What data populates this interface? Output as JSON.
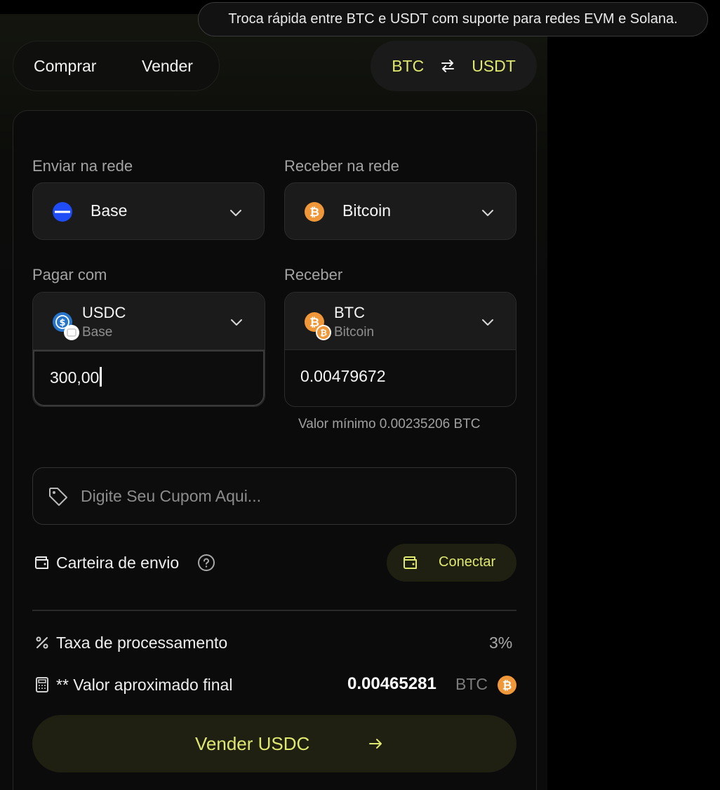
{
  "tooltip": "Troca rápida entre BTC e USDT com suporte para redes EVM e Solana.",
  "mode": {
    "buy": "Comprar",
    "sell": "Vender"
  },
  "pair": {
    "from": "BTC",
    "to": "USDT"
  },
  "send_network": {
    "label": "Enviar na rede",
    "value": "Base"
  },
  "receive_network": {
    "label": "Receber na rede",
    "value": "Bitcoin"
  },
  "pay": {
    "label": "Pagar com",
    "symbol": "USDC",
    "network": "Base",
    "amount": "300,00"
  },
  "receive": {
    "label": "Receber",
    "symbol": "BTC",
    "network": "Bitcoin",
    "amount": "0.00479672"
  },
  "min_note": "Valor mínimo 0.00235206 BTC",
  "coupon": {
    "placeholder": "Digite Seu Cupom Aqui..."
  },
  "wallet": {
    "label": "Carteira de envio",
    "connect": "Conectar"
  },
  "fee": {
    "label": "Taxa de processamento",
    "value": "3%"
  },
  "final": {
    "label": "** Valor aproximado final",
    "value": "0.00465281",
    "unit": "BTC"
  },
  "submit": {
    "label": "Vender USDC"
  },
  "colors": {
    "accent": "#dfe86e",
    "base_blue": "#1f4cf5",
    "btc_orange": "#f0973a",
    "usdc_blue": "#2775ca"
  },
  "icons": [
    "swap-arrows-icon",
    "base-network-icon",
    "bitcoin-icon",
    "usdc-icon",
    "chevron-down-icon",
    "tag-icon",
    "wallet-icon",
    "help-circle-icon",
    "percent-icon",
    "calculator-icon",
    "arrow-right-icon"
  ]
}
